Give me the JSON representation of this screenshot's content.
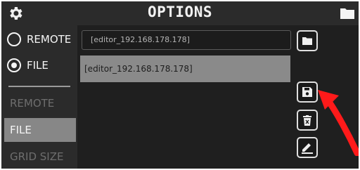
{
  "header": {
    "title": "OPTIONS",
    "gear_icon": "gear-icon",
    "folder_icon": "folder-icon"
  },
  "sidebar": {
    "radios": [
      {
        "label": "REMOTE",
        "selected": false
      },
      {
        "label": "FILE",
        "selected": true
      }
    ],
    "items": [
      {
        "label": "REMOTE",
        "active": false
      },
      {
        "label": "FILE",
        "active": true
      },
      {
        "label": "GRID SIZE",
        "active": false
      }
    ]
  },
  "main": {
    "path_value": "[editor_192.168.178.178]",
    "list_items": [
      "[editor_192.168.178.178]"
    ],
    "buttons": {
      "browse_icon": "folder-icon",
      "save_icon": "save-icon",
      "delete_icon": "delete-icon",
      "rename_icon": "pencil-icon"
    }
  },
  "colors": {
    "accent_arrow": "#ff1a1a",
    "background": "#1f1f1f",
    "selected_item": "#8a8a8a"
  }
}
